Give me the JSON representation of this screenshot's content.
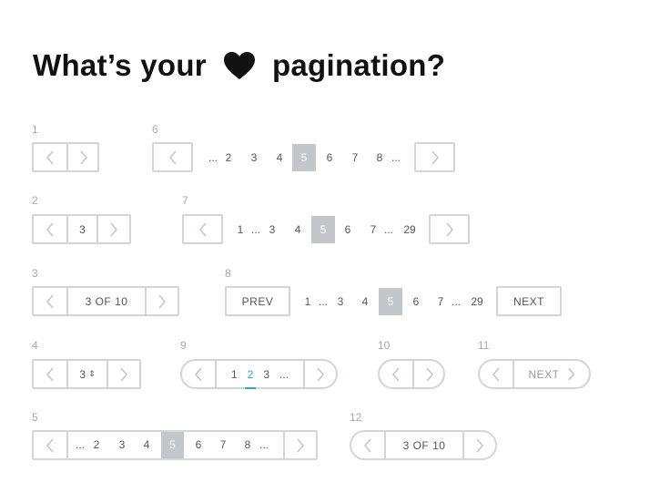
{
  "title": {
    "before": "What’s your",
    "after": "pagination?",
    "heart_icon": "heart-icon"
  },
  "labels": [
    "1",
    "2",
    "3",
    "4",
    "5",
    "6",
    "7",
    "8",
    "9",
    "10",
    "11",
    "12"
  ],
  "colors": {
    "border": "#d3d6d9",
    "active_bg": "#c3c7ca",
    "accent": "#2aa6d6",
    "label": "#a9a9a9"
  },
  "ex2": {
    "page": "3"
  },
  "ex3": {
    "text": "3 OF 10"
  },
  "ex4": {
    "page": "3",
    "stepper": "⇕"
  },
  "ex5": {
    "pages": [
      "...",
      "2",
      "3",
      "4",
      "5",
      "6",
      "7",
      "8",
      "..."
    ]
  },
  "ex6": {
    "pages": [
      "...",
      "2",
      "3",
      "4",
      "5",
      "6",
      "7",
      "8",
      "..."
    ]
  },
  "ex7": {
    "pages": [
      "1",
      "...",
      "3",
      "4",
      "5",
      "6",
      "7",
      "...",
      "29"
    ]
  },
  "ex8": {
    "prev": "PREV",
    "next": "NEXT",
    "pages": [
      "1",
      "...",
      "3",
      "4",
      "5",
      "6",
      "7",
      "...",
      "29"
    ]
  },
  "ex9": {
    "pages": [
      "1",
      "2",
      "3",
      "..."
    ]
  },
  "ex11": {
    "next": "NEXT"
  },
  "ex12": {
    "text": "3 OF 10"
  }
}
